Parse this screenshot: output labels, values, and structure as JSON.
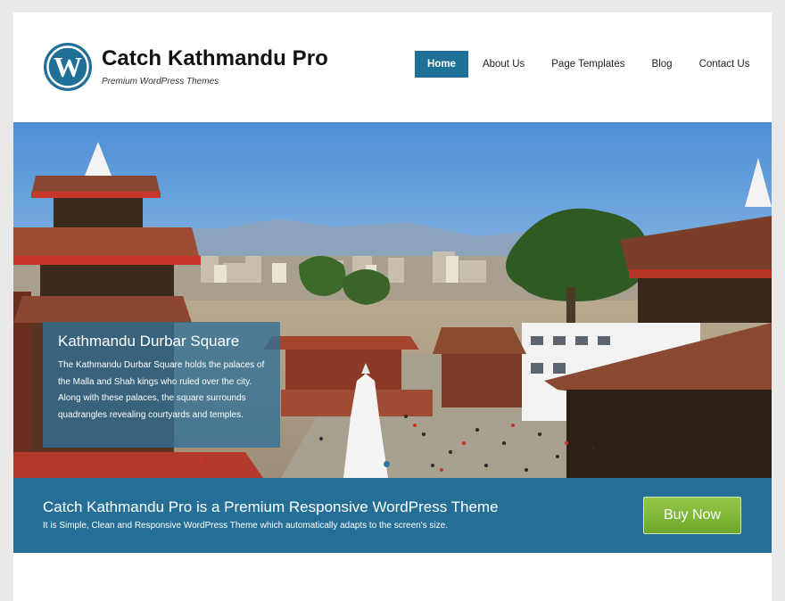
{
  "header": {
    "site_title": "Catch Kathmandu Pro",
    "tagline": "Premium WordPress Themes",
    "logo_icon": "wordpress-logo-icon"
  },
  "nav": {
    "items": [
      {
        "label": "Home",
        "active": true
      },
      {
        "label": "About Us",
        "active": false
      },
      {
        "label": "Page Templates",
        "active": false
      },
      {
        "label": "Blog",
        "active": false
      },
      {
        "label": "Contact Us",
        "active": false
      }
    ]
  },
  "slider": {
    "image": "Kathmandu Durbar Square photo",
    "caption_title": "Kathmandu Durbar Square",
    "caption_text": "The Kathmandu Durbar Square holds the palaces of the Malla and Shah kings who ruled over the city. Along with these palaces, the square surrounds quadrangles revealing courtyards and temples.",
    "dots": [
      {
        "active": true
      },
      {
        "active": false
      }
    ]
  },
  "promo": {
    "title": "Catch Kathmandu Pro is a Premium Responsive WordPress Theme",
    "text": "It is Simple, Clean and Responsive WordPress Theme which automatically adapts to the screen's size.",
    "button_label": "Buy Now"
  },
  "colors": {
    "accent": "#1f7097",
    "promo_bg": "#256f96",
    "button_green": "#7ab536"
  }
}
